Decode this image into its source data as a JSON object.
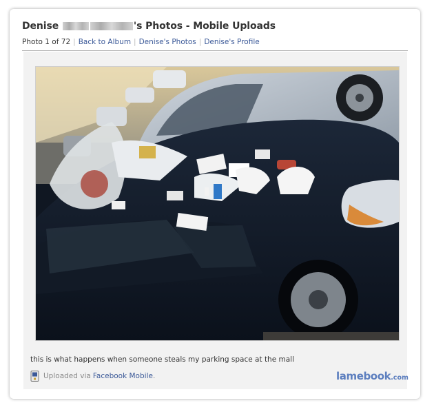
{
  "header": {
    "name_first": "Denise",
    "title_suffix": "'s Photos - Mobile Uploads"
  },
  "subnav": {
    "counter": "Photo 1 of 72",
    "links": [
      "Back to Album",
      "Denise's Photos",
      "Denise's Profile"
    ]
  },
  "photo": {
    "caption": "this is what happens when someone steals my parking space at the mall"
  },
  "upload": {
    "prefix": "Uploaded via",
    "link": "Facebook Mobile",
    "suffix": "."
  },
  "watermark": {
    "brand": "lamebook",
    "domain": ".com"
  },
  "colors": {
    "link": "#3b5998",
    "watermark": "#5d7fbf"
  }
}
